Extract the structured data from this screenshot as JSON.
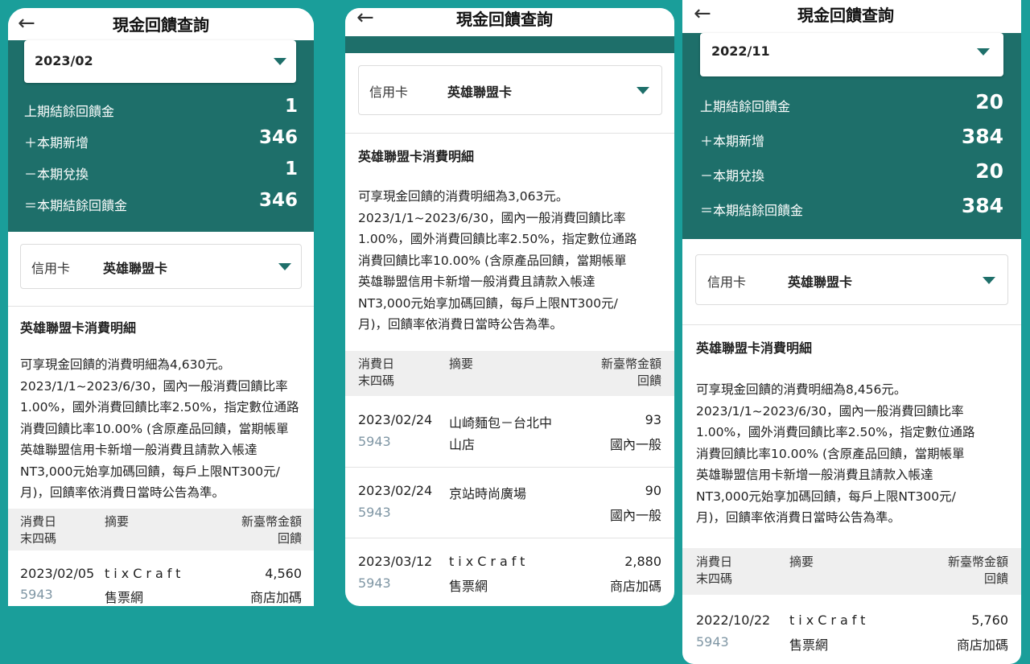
{
  "colors": {
    "background": "#1a9e9a",
    "header_green": "#1e6f6a",
    "accent_caret": "#1e6f6a",
    "card_number": "#7f96a4"
  },
  "icons": {
    "back": "arrow-left-icon",
    "dropdown": "caret-down-icon"
  },
  "panels": [
    {
      "title": "現金回饋查詢",
      "back_glyph": "←",
      "period": "2023/02",
      "summary": [
        {
          "label": "上期結餘回饋金",
          "value": "1"
        },
        {
          "label": "＋本期新增",
          "value": "346"
        },
        {
          "label": "－本期兌換",
          "value": "1"
        },
        {
          "label": "＝本期結餘回饋金",
          "value": "346"
        }
      ],
      "card_type_label": "信用卡",
      "card_name": "英雄聯盟卡",
      "section_title": "英雄聯盟卡消費明細",
      "desc_lines": [
        "可享現金回饋的消費明細為4,630元。",
        "2023/1/1~2023/6/30，國內一般消費回饋比率",
        "1.00%，國外消費回饋比率2.50%，指定數位通路",
        "消費回饋比率10.00% (含原產品回饋，當期帳單",
        "英雄聯盟信用卡新增一般消費且請款入帳達",
        "NT3,000元始享加碼回饋，每戶上限NT300元/",
        "月)，回饋率依消費日當時公告為準。"
      ],
      "table_headers": {
        "date": "消費日",
        "card_tail": "末四碼",
        "summary": "摘要",
        "amount": "新臺幣金額",
        "reward": "回饋"
      },
      "rows": [
        {
          "date": "2023/02/05",
          "card": "5943",
          "merchant1": "tixCraft",
          "merchant2": "售票網",
          "amount": "4,560",
          "type": "商店加碼"
        }
      ]
    },
    {
      "title": "現金回饋查詢",
      "back_glyph": "←",
      "card_type_label": "信用卡",
      "card_name": "英雄聯盟卡",
      "section_title": "英雄聯盟卡消費明細",
      "desc_lines": [
        "可享現金回饋的消費明細為3,063元。",
        "2023/1/1~2023/6/30，國內一般消費回饋比率",
        "1.00%，國外消費回饋比率2.50%，指定數位通路",
        "消費回饋比率10.00% (含原產品回饋，當期帳單",
        "英雄聯盟信用卡新增一般消費且請款入帳達",
        "NT3,000元始享加碼回饋，每戶上限NT300元/",
        "月)，回饋率依消費日當時公告為準。"
      ],
      "table_headers": {
        "date": "消費日",
        "card_tail": "末四碼",
        "summary": "摘要",
        "amount": "新臺幣金額",
        "reward": "回饋"
      },
      "rows": [
        {
          "date": "2023/02/24",
          "card": "5943",
          "merchant1": "山崎麵包－台北中",
          "merchant2": "山店",
          "amount": "93",
          "type": "國內一般"
        },
        {
          "date": "2023/02/24",
          "card": "5943",
          "merchant1": "京站時尚廣場",
          "merchant2": "",
          "amount": "90",
          "type": "國內一般"
        },
        {
          "date": "2023/03/12",
          "card": "5943",
          "merchant1": "tixCraft",
          "merchant2": "售票網",
          "amount": "2,880",
          "type": "商店加碼"
        }
      ]
    },
    {
      "title": "現金回饋查詢",
      "back_glyph": "←",
      "period": "2022/11",
      "summary": [
        {
          "label": "上期結餘回饋金",
          "value": "20"
        },
        {
          "label": "＋本期新增",
          "value": "384"
        },
        {
          "label": "－本期兌換",
          "value": "20"
        },
        {
          "label": "＝本期結餘回饋金",
          "value": "384"
        }
      ],
      "card_type_label": "信用卡",
      "card_name": "英雄聯盟卡",
      "section_title": "英雄聯盟卡消費明細",
      "desc_lines": [
        "可享現金回饋的消費明細為8,456元。",
        "2023/1/1~2023/6/30，國內一般消費回饋比率",
        "1.00%，國外消費回饋比率2.50%，指定數位通路",
        "消費回饋比率10.00% (含原產品回饋，當期帳單",
        "英雄聯盟信用卡新增一般消費且請款入帳達",
        "NT3,000元始享加碼回饋，每戶上限NT300元/",
        "月)，回饋率依消費日當時公告為準。"
      ],
      "table_headers": {
        "date": "消費日",
        "card_tail": "末四碼",
        "summary": "摘要",
        "amount": "新臺幣金額",
        "reward": "回饋"
      },
      "rows": [
        {
          "date": "2022/10/22",
          "card": "5943",
          "merchant1": "tixCraft",
          "merchant2": "售票網",
          "amount": "5,760",
          "type": "商店加碼"
        }
      ]
    }
  ]
}
